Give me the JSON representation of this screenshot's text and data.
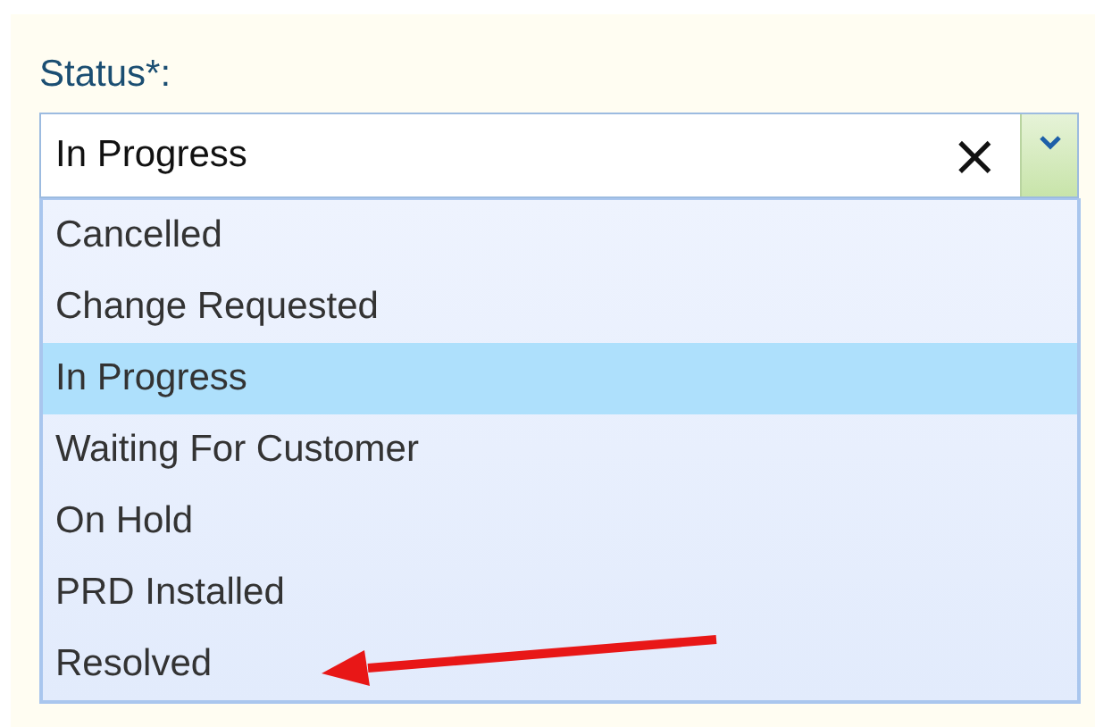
{
  "field": {
    "label": "Status*:",
    "value": "In Progress",
    "clear": "×"
  },
  "options": [
    {
      "label": "Cancelled",
      "selected": false
    },
    {
      "label": "Change Requested",
      "selected": false
    },
    {
      "label": "In Progress",
      "selected": true
    },
    {
      "label": "Waiting For Customer",
      "selected": false
    },
    {
      "label": "On Hold",
      "selected": false
    },
    {
      "label": "PRD Installed",
      "selected": false
    },
    {
      "label": "Resolved",
      "selected": false
    }
  ]
}
